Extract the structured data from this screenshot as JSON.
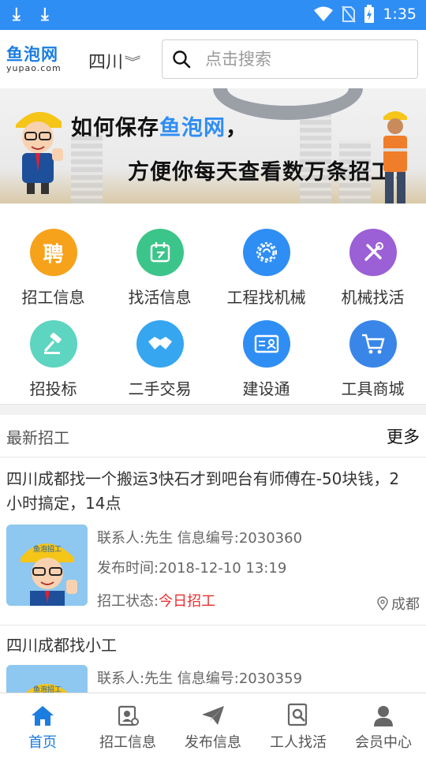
{
  "status_bar": {
    "time": "1:35"
  },
  "header": {
    "logo_text": "鱼泡网",
    "logo_sub": "yupao.com",
    "city": "四川",
    "search_placeholder": "点击搜索"
  },
  "banner": {
    "line1_prefix": "如何保存",
    "line1_highlight": "鱼泡网",
    "line1_suffix": "，",
    "line2": "方便你每天查看数万条招工！"
  },
  "categories": [
    {
      "label": "招工信息",
      "color": "#f7a21b",
      "glyph": "聘"
    },
    {
      "label": "找活信息",
      "color": "#3cc58a",
      "glyph": ""
    },
    {
      "label": "工程找机械",
      "color": "#2f8ef4",
      "glyph": ""
    },
    {
      "label": "机械找活",
      "color": "#9b5fd6",
      "glyph": ""
    },
    {
      "label": "招投标",
      "color": "#5dd5c0",
      "glyph": ""
    },
    {
      "label": "二手交易",
      "color": "#37a6f0",
      "glyph": ""
    },
    {
      "label": "建设通",
      "color": "#2f8ef4",
      "glyph": ""
    },
    {
      "label": "工具商城",
      "color": "#3a86e8",
      "glyph": ""
    }
  ],
  "latest": {
    "title": "最新招工",
    "more": "更多",
    "jobs": [
      {
        "title": "四川成都找一个搬运3快石才到吧台有师傅在-50块钱，2小时搞定，14点",
        "contact_line": "联系人:先生 信息编号:2030360",
        "time_line": "发布时间:2018-12-10 13:19",
        "status_label": "招工状态:",
        "status_value": "今日招工",
        "location": "成都",
        "thumb_badge": "鱼泡招工"
      },
      {
        "title": "四川成都找小工",
        "contact_line": "联系人:先生 信息编号:2030359",
        "thumb_badge": "鱼泡招工"
      }
    ]
  },
  "tabbar": [
    {
      "label": "首页",
      "active": true
    },
    {
      "label": "招工信息",
      "active": false
    },
    {
      "label": "发布信息",
      "active": false
    },
    {
      "label": "工人找活",
      "active": false
    },
    {
      "label": "会员中心",
      "active": false
    }
  ],
  "colors": {
    "accent": "#2f8ef4",
    "status_red": "#e8312f"
  }
}
